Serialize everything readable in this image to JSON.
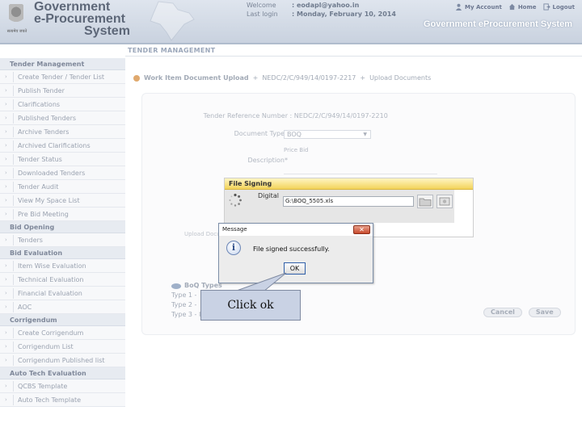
{
  "header": {
    "logo_title": [
      "Government",
      "e-Procurement",
      "System"
    ],
    "emblem_motto": "सत्यमेव जयते",
    "user_info": [
      {
        "label": "Welcome",
        "value": ": eodapl@yahoo.in"
      },
      {
        "label": "Last login",
        "value": ": Monday, February 10, 2014"
      }
    ],
    "links": [
      {
        "label": "My Account",
        "icon": "user-icon"
      },
      {
        "label": "Home",
        "icon": "home-icon"
      },
      {
        "label": "Logout",
        "icon": "logout-icon"
      }
    ],
    "system_name": "Government eProcurement System"
  },
  "sidebar": {
    "sections": [
      {
        "title": "Tender Management",
        "items": [
          "Create Tender / Tender List",
          "Publish Tender",
          "Clarifications",
          "Published Tenders",
          "Archive Tenders",
          "Archived Clarifications",
          "Tender Status",
          "Downloaded Tenders",
          "Tender Audit",
          "View My Space List",
          "Pre Bid Meeting"
        ]
      },
      {
        "title": "Bid Opening",
        "items": [
          "Tenders"
        ]
      },
      {
        "title": "Bid Evaluation",
        "items": [
          "Item Wise Evaluation",
          "Technical Evaluation",
          "Financial Evaluation",
          "AOC"
        ]
      },
      {
        "title": "Corrigendum",
        "items": [
          "Create Corrigendum",
          "Corrigendum List",
          "Corrigendum Published list"
        ]
      },
      {
        "title": "Auto Tech Evaluation",
        "items": [
          "QCBS Template",
          "Auto Tech Template"
        ]
      }
    ]
  },
  "main": {
    "title": "TENDER MANAGEMENT",
    "breadcrumb": [
      "Work Item Document Upload",
      "+",
      "NEDC/2/C/949/14/0197-2217",
      "+",
      "Upload Documents"
    ],
    "form": {
      "tender_ref_label": "Tender Reference Number",
      "tender_ref_value": "NEDC/2/C/949/14/0197-2210",
      "doc_type_label": "Document Type*",
      "doc_type_value": "BOQ",
      "description_label": "Description*",
      "description_value": "Price Bid",
      "upload_label": "Upload Document",
      "cancel_label": "Cancel",
      "save_label": "Save"
    },
    "boq_types": {
      "title": "BoQ Types",
      "items": [
        "Type 1 -",
        "Type 2 -",
        "Type 3 - Item Rate BoQ"
      ]
    }
  },
  "sign_dialog": {
    "title": "File Signing",
    "digital_label": "Digital",
    "file_path": "G:\\BOQ_5505.xls"
  },
  "message_dialog": {
    "title": "Message",
    "close": "✕",
    "text": "File signed successfully.",
    "ok_label": "OK"
  },
  "callout": {
    "text": "Click ok"
  }
}
